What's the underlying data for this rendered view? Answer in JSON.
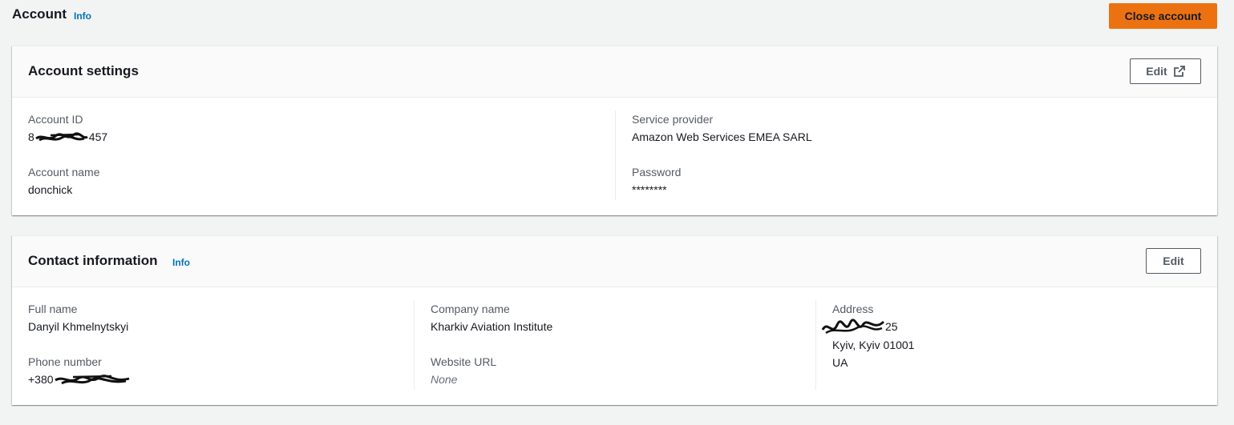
{
  "page": {
    "title": "Account",
    "info_label": "Info",
    "close_account_label": "Close account"
  },
  "account_settings": {
    "title": "Account settings",
    "edit_label": "Edit",
    "fields": {
      "account_id_label": "Account ID",
      "account_id_prefix": "8",
      "account_id_suffix": "457",
      "account_name_label": "Account name",
      "account_name_value": "donchick",
      "service_provider_label": "Service provider",
      "service_provider_value": "Amazon Web Services EMEA SARL",
      "password_label": "Password",
      "password_value": "********"
    }
  },
  "contact_information": {
    "title": "Contact information",
    "info_label": "Info",
    "edit_label": "Edit",
    "fields": {
      "full_name_label": "Full name",
      "full_name_value": "Danyil Khmelnytskyi",
      "phone_label": "Phone number",
      "phone_prefix": "+380",
      "company_label": "Company name",
      "company_value": "Kharkiv Aviation Institute",
      "website_label": "Website URL",
      "website_value": "None",
      "address_label": "Address",
      "address_line1_suffix": "25",
      "address_line2": "Kyiv, Kyiv 01001",
      "address_line3": "UA"
    }
  },
  "colors": {
    "primary_button": "#ec7211",
    "link": "#0073bb",
    "background": "#f2f3f3"
  },
  "icons": [
    "external-link-icon",
    "redaction-scribble"
  ]
}
